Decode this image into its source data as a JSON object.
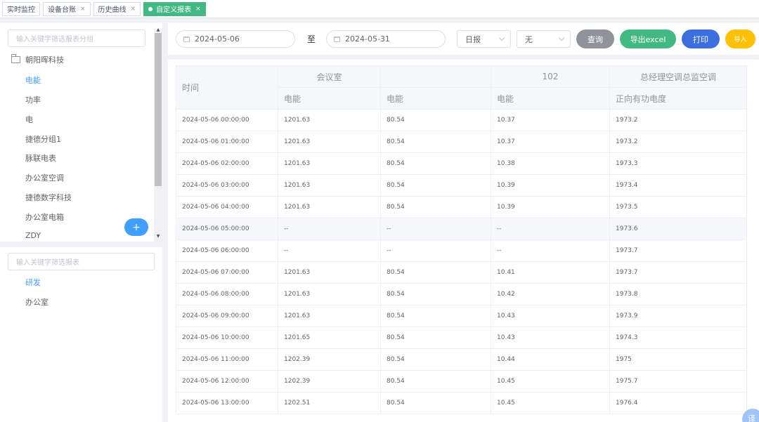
{
  "tabs": [
    {
      "label": "实时监控",
      "closable": false,
      "active": false
    },
    {
      "label": "设备台账",
      "closable": true,
      "active": false
    },
    {
      "label": "历史曲线",
      "closable": true,
      "active": false
    },
    {
      "label": "自定义报表",
      "closable": true,
      "active": true
    }
  ],
  "close_glyph": "×",
  "left_top": {
    "filter_placeholder": "输入关键字筛选报表分组",
    "root": "朝阳晖科技",
    "items": [
      "电能",
      "功率",
      "电",
      "捷德分组1",
      "脉联电表",
      "办公室空调",
      "捷德数字科技",
      "办公室电箱",
      "ZDY"
    ],
    "selected_index": 0,
    "add_glyph": "+"
  },
  "left_bottom": {
    "filter_placeholder": "输入关键字筛选报表",
    "items": [
      "研发",
      "办公室"
    ],
    "selected_index": 0
  },
  "toolbar": {
    "start_date": "2024-05-06",
    "to_label": "至",
    "end_date": "2024-05-31",
    "period": "日报",
    "option": "无",
    "query": "查询",
    "export": "导出excel",
    "print": "打印",
    "import": "导入"
  },
  "colors": {
    "primary": "#409eff",
    "success": "#42b983",
    "query": "#909399",
    "import": "#ffc107"
  },
  "table": {
    "time_header": "时间",
    "groups": [
      "会议室",
      "",
      "102",
      "总经理空调总监空调"
    ],
    "subheaders": [
      "电能",
      "电能",
      "电能",
      "正向有功电度"
    ],
    "rows": [
      [
        "2024-05-06 00:00:00",
        "1201.63",
        "80.54",
        "10.37",
        "1973.2"
      ],
      [
        "2024-05-06 01:00:00",
        "1201.63",
        "80.54",
        "10.37",
        "1973.2"
      ],
      [
        "2024-05-06 02:00:00",
        "1201.63",
        "80.54",
        "10.38",
        "1973.3"
      ],
      [
        "2024-05-06 03:00:00",
        "1201.63",
        "80.54",
        "10.39",
        "1973.4"
      ],
      [
        "2024-05-06 04:00:00",
        "1201.63",
        "80.54",
        "10.39",
        "1973.5"
      ],
      [
        "2024-05-06 05:00:00",
        "--",
        "--",
        "--",
        "1973.6"
      ],
      [
        "2024-05-06 06:00:00",
        "--",
        "--",
        "--",
        "1973.7"
      ],
      [
        "2024-05-06 07:00:00",
        "1201.63",
        "80.54",
        "10.41",
        "1973.7"
      ],
      [
        "2024-05-06 08:00:00",
        "1201.63",
        "80.54",
        "10.42",
        "1973.8"
      ],
      [
        "2024-05-06 09:00:00",
        "1201.63",
        "80.54",
        "10.43",
        "1973.9"
      ],
      [
        "2024-05-06 10:00:00",
        "1201.65",
        "80.54",
        "10.43",
        "1974.3"
      ],
      [
        "2024-05-06 11:00:00",
        "1202.39",
        "80.54",
        "10.44",
        "1975"
      ],
      [
        "2024-05-06 12:00:00",
        "1202.39",
        "80.54",
        "10.45",
        "1975.7"
      ],
      [
        "2024-05-06 13:00:00",
        "1202.51",
        "80.54",
        "10.45",
        "1976.4"
      ]
    ],
    "hover_row": 5
  },
  "corner_badge": "译"
}
